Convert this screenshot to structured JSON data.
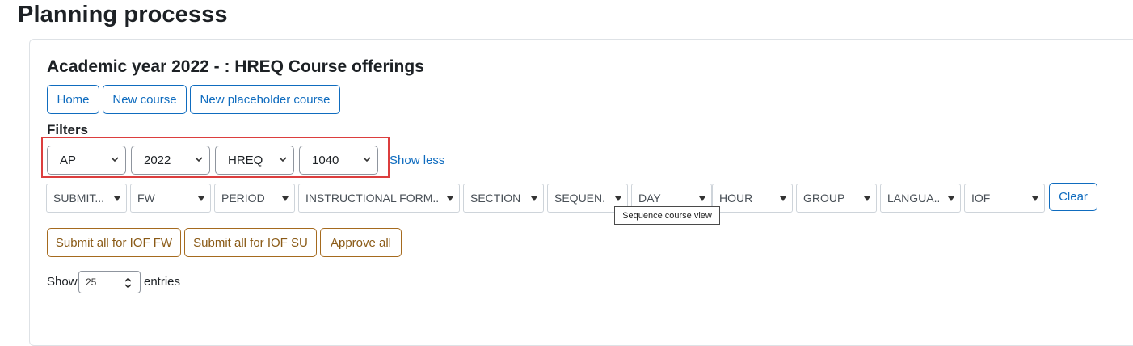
{
  "page": {
    "title": "Planning processs"
  },
  "section": {
    "title": "Academic year 2022 - : HREQ Course offerings"
  },
  "actions": {
    "home": "Home",
    "new_course": "New course",
    "new_placeholder": "New placeholder course"
  },
  "filters": {
    "label": "Filters",
    "primary": [
      "AP",
      "2022",
      "HREQ",
      "1040"
    ],
    "show_less": "Show less",
    "secondary": [
      "SUBMIT...",
      "FW",
      "PERIOD",
      "INSTRUCTIONAL FORM...",
      "SECTION",
      "SEQUEN...",
      "DAY",
      "HOUR",
      "GROUP",
      "LANGUA...",
      "IOF"
    ],
    "clear": "Clear"
  },
  "tooltip": {
    "text": "Sequence course view"
  },
  "bulk": {
    "submit_fw": "Submit all for IOF FW",
    "submit_su": "Submit all for IOF SU",
    "approve": "Approve all"
  },
  "entries": {
    "show": "Show",
    "value": "25",
    "suffix": "entries"
  },
  "colors": {
    "primary": "#0f6cbf",
    "gold": "#a56a1e",
    "highlight": "#dc3e3e"
  }
}
